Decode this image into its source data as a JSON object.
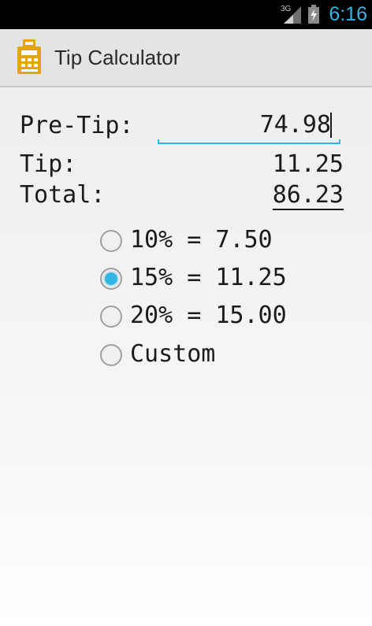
{
  "status_bar": {
    "network_label": "3G",
    "time": "6:16",
    "signal_icon": "signal-icon",
    "battery_icon": "battery-charging-icon"
  },
  "action_bar": {
    "icon": "calculator-icon",
    "title": "Tip Calculator"
  },
  "form": {
    "pretip_label": "Pre-Tip:",
    "pretip_value": "74.98",
    "tip_label": "Tip:",
    "tip_value": "11.25",
    "total_label": "Total:",
    "total_value": "86.23"
  },
  "options": [
    {
      "label": "10% = 7.50",
      "checked": false
    },
    {
      "label": "15% = 11.25",
      "checked": true
    },
    {
      "label": "20% = 15.00",
      "checked": false
    },
    {
      "label": "Custom",
      "checked": false
    }
  ],
  "colors": {
    "accent": "#33b5e5",
    "status_bar_bg": "#000000",
    "action_bar_bg": "#e4e4e4",
    "app_icon": "#e5a40a"
  }
}
